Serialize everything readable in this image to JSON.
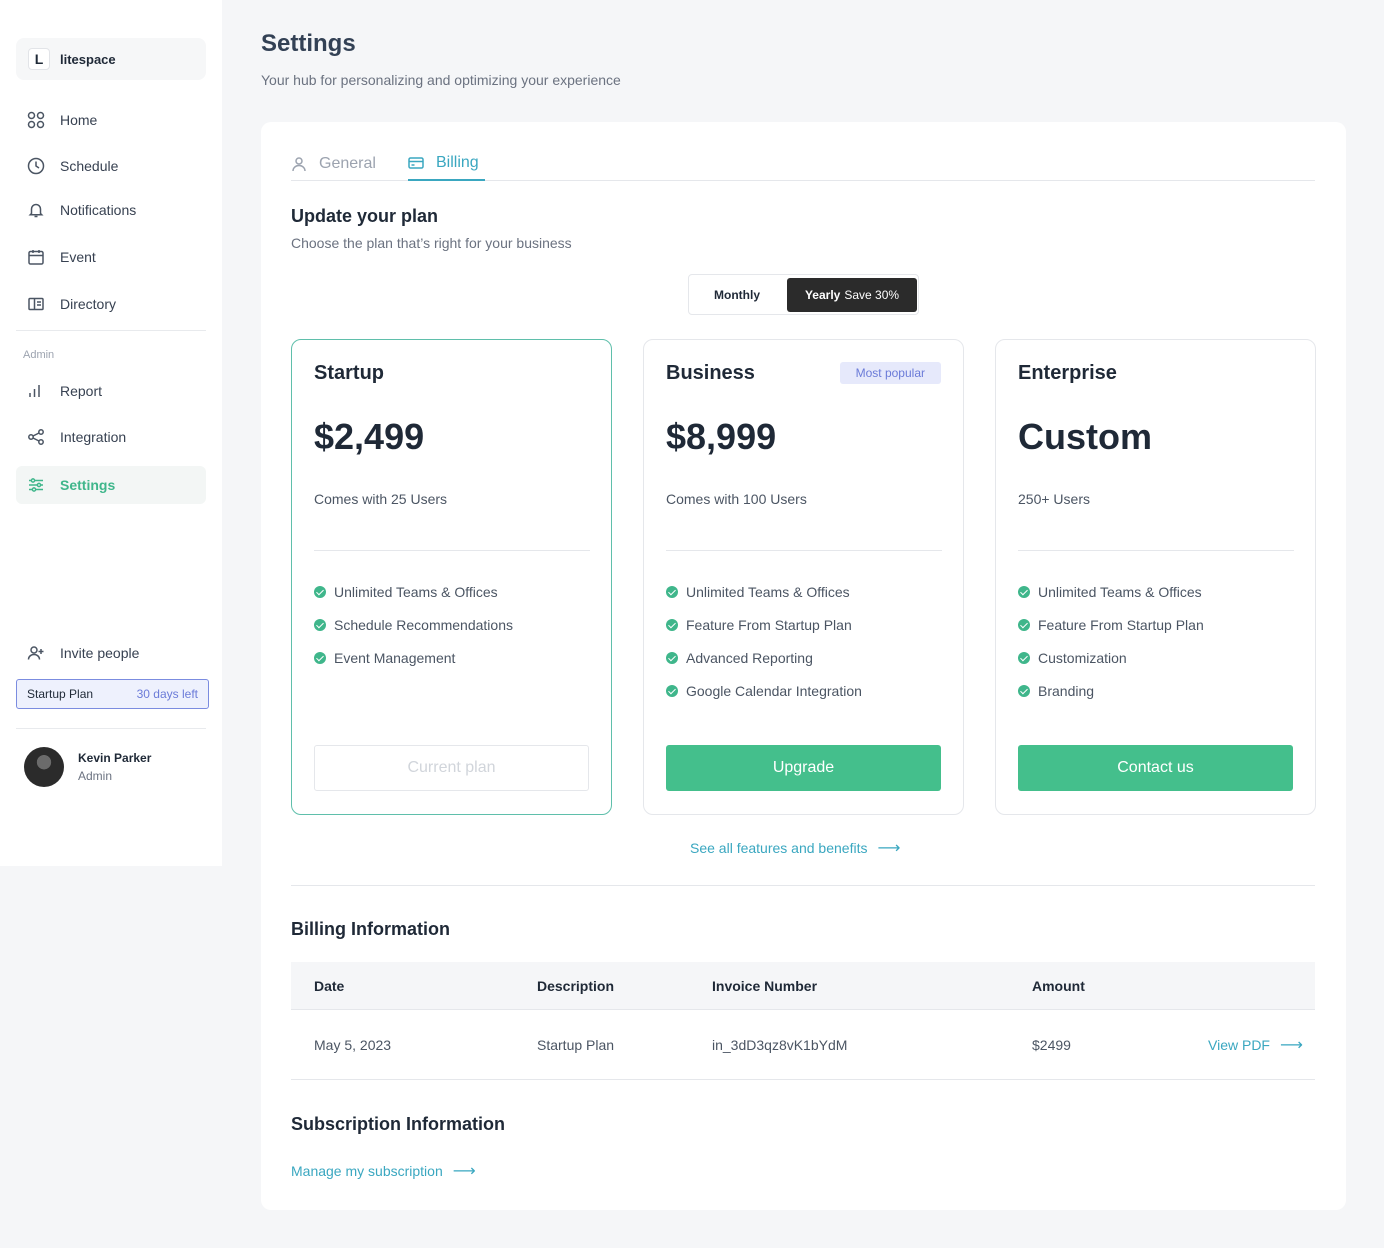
{
  "brand": {
    "mark": "L",
    "name": "litespace"
  },
  "sidebar": {
    "items": [
      {
        "label": "Home",
        "icon": "grid-icon"
      },
      {
        "label": "Schedule",
        "icon": "clock-icon"
      },
      {
        "label": "Notifications",
        "icon": "bell-icon"
      },
      {
        "label": "Event",
        "icon": "calendar-icon"
      },
      {
        "label": "Directory",
        "icon": "directory-icon"
      }
    ],
    "admin_label": "Admin",
    "admin_items": [
      {
        "label": "Report",
        "icon": "bar-chart-icon"
      },
      {
        "label": "Integration",
        "icon": "share-icon"
      },
      {
        "label": "Settings",
        "icon": "sliders-icon",
        "active": true
      }
    ],
    "invite_label": "Invite people",
    "plan_chip": {
      "name": "Startup Plan",
      "days": "30 days left"
    },
    "user": {
      "name": "Kevin Parker",
      "role": "Admin"
    }
  },
  "header": {
    "title": "Settings",
    "subtitle": "Your hub for personalizing and optimizing your experience"
  },
  "tabs": [
    {
      "label": "General",
      "active": false
    },
    {
      "label": "Billing",
      "active": true
    }
  ],
  "plans_section": {
    "title": "Update your plan",
    "subtitle": "Choose the plan that’s right for your business",
    "toggle": {
      "monthly": "Monthly",
      "yearly": "Yearly",
      "save": "Save 30%",
      "selected": "Yearly"
    }
  },
  "plans": [
    {
      "name": "Startup",
      "price": "$2,499",
      "users": "Comes with 25 Users",
      "features": [
        "Unlimited Teams & Offices",
        "Schedule Recommendations",
        "Event Management"
      ],
      "button": "Current plan",
      "current": true
    },
    {
      "name": "Business",
      "badge": "Most popular",
      "price": "$8,999",
      "users": "Comes with 100 Users",
      "features": [
        "Unlimited Teams & Offices",
        "Feature From Startup Plan",
        "Advanced Reporting",
        "Google Calendar Integration"
      ],
      "button": "Upgrade"
    },
    {
      "name": "Enterprise",
      "price": "Custom",
      "users": "250+ Users",
      "features": [
        "Unlimited Teams & Offices",
        "Feature From Startup Plan",
        "Customization",
        "Branding"
      ],
      "button": "Contact us"
    }
  ],
  "features_link": "See all features and benefits",
  "billing": {
    "title": "Billing Information",
    "columns": [
      "Date",
      "Description",
      "Invoice Number",
      "Amount"
    ],
    "rows": [
      {
        "date": "May 5, 2023",
        "description": "Startup Plan",
        "invoice": "in_3dD3qz8vK1bYdM",
        "amount": "$2499",
        "action": "View PDF"
      }
    ]
  },
  "subscription": {
    "title": "Subscription Information",
    "link": "Manage my subscription"
  },
  "colors": {
    "accent": "#44bf8c",
    "link": "#3aa7c0",
    "badge": "#6b7bd8"
  }
}
